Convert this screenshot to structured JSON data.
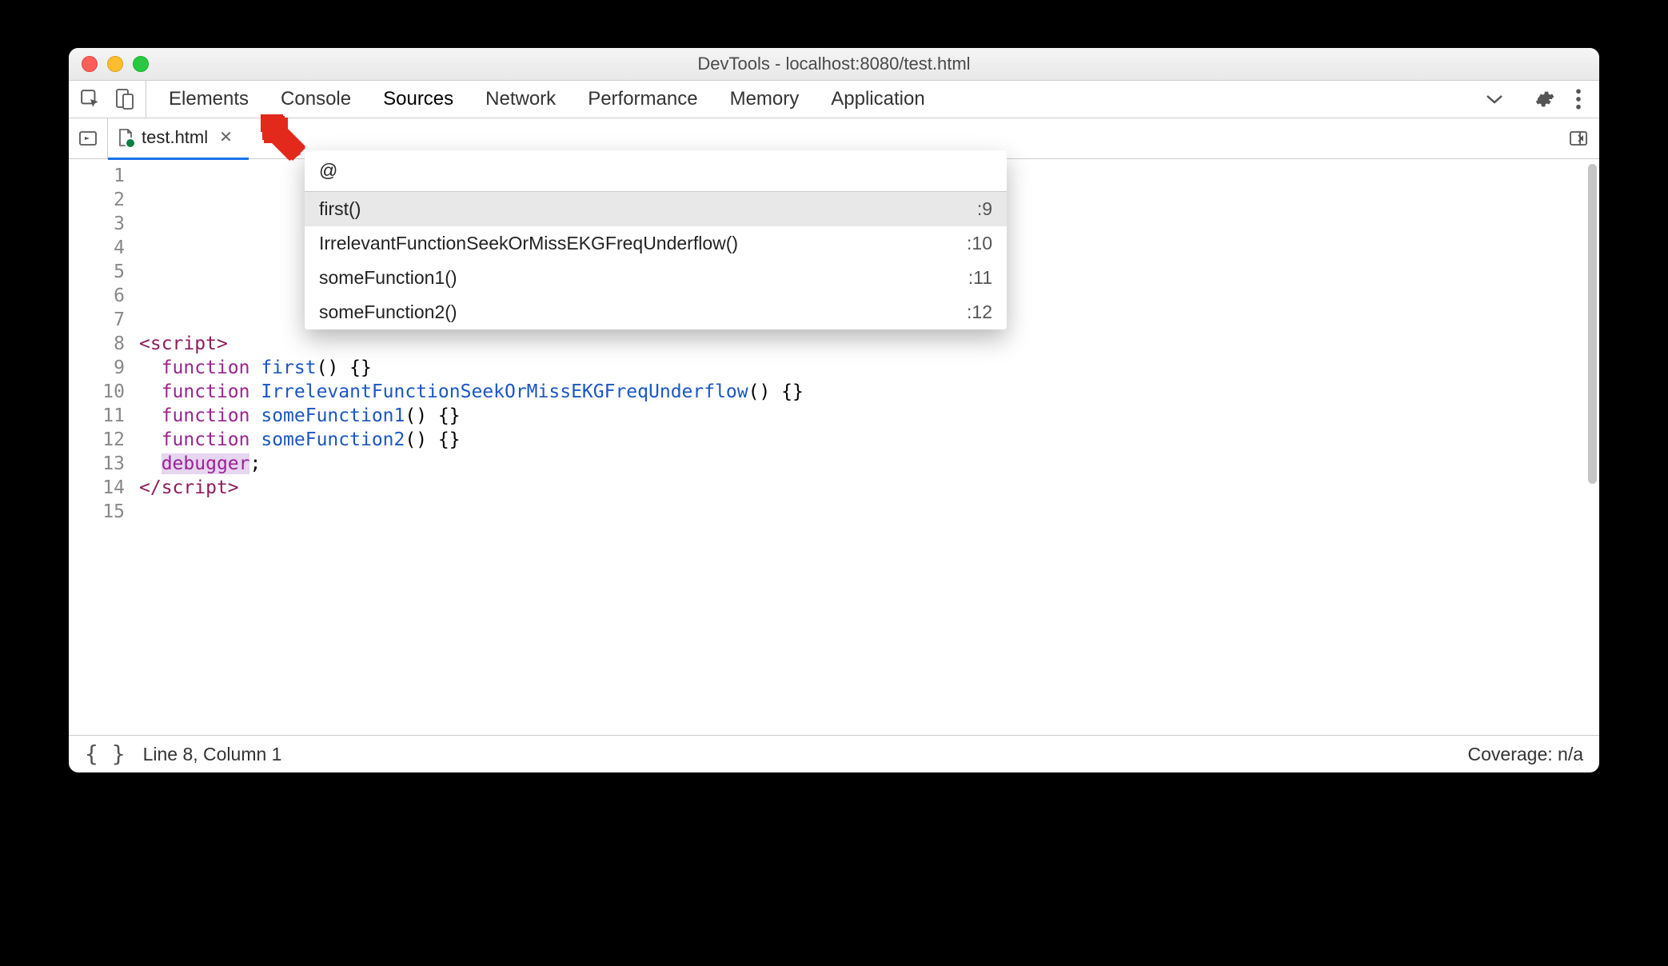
{
  "window": {
    "title": "DevTools - localhost:8080/test.html"
  },
  "toolbar": {
    "tabs": [
      "Elements",
      "Console",
      "Sources",
      "Network",
      "Performance",
      "Memory",
      "Application"
    ],
    "active_tab": "Sources"
  },
  "file": {
    "name": "test.html"
  },
  "command_menu": {
    "query": "@",
    "items": [
      {
        "label": "first()",
        "line": ":9"
      },
      {
        "label": "IrrelevantFunctionSeekOrMissEKGFreqUnderflow()",
        "line": ":10"
      },
      {
        "label": "someFunction1()",
        "line": ":11"
      },
      {
        "label": "someFunction2()",
        "line": ":12"
      }
    ],
    "selected_index": 0
  },
  "editor": {
    "line_numbers": [
      "1",
      "2",
      "3",
      "4",
      "5",
      "6",
      "7",
      "8",
      "9",
      "10",
      "11",
      "12",
      "13",
      "14",
      "15"
    ],
    "lines": [
      {
        "tokens": []
      },
      {
        "tokens": []
      },
      {
        "tokens": []
      },
      {
        "tokens": []
      },
      {
        "tokens": []
      },
      {
        "tokens": []
      },
      {
        "tokens": []
      },
      {
        "tokens": [
          {
            "t": "<",
            "c": "tag"
          },
          {
            "t": "script",
            "c": "tag"
          },
          {
            "t": ">",
            "c": "tag"
          }
        ]
      },
      {
        "tokens": [
          {
            "t": "  "
          },
          {
            "t": "function",
            "c": "kw"
          },
          {
            "t": " "
          },
          {
            "t": "first",
            "c": "fn"
          },
          {
            "t": "() {}"
          }
        ]
      },
      {
        "tokens": [
          {
            "t": "  "
          },
          {
            "t": "function",
            "c": "kw"
          },
          {
            "t": " "
          },
          {
            "t": "IrrelevantFunctionSeekOrMissEKGFreqUnderflow",
            "c": "fn"
          },
          {
            "t": "() {}"
          }
        ]
      },
      {
        "tokens": [
          {
            "t": "  "
          },
          {
            "t": "function",
            "c": "kw"
          },
          {
            "t": " "
          },
          {
            "t": "someFunction1",
            "c": "fn"
          },
          {
            "t": "() {}"
          }
        ]
      },
      {
        "tokens": [
          {
            "t": "  "
          },
          {
            "t": "function",
            "c": "kw"
          },
          {
            "t": " "
          },
          {
            "t": "someFunction2",
            "c": "fn"
          },
          {
            "t": "() {}"
          }
        ]
      },
      {
        "tokens": [
          {
            "t": "  "
          },
          {
            "t": "debugger",
            "c": "kw dbg"
          },
          {
            "t": ";"
          }
        ]
      },
      {
        "tokens": [
          {
            "t": "</",
            "c": "tag"
          },
          {
            "t": "script",
            "c": "tag"
          },
          {
            "t": ">",
            "c": "tag"
          }
        ]
      },
      {
        "tokens": []
      }
    ]
  },
  "statusbar": {
    "position": "Line 8, Column 1",
    "coverage": "Coverage: n/a"
  }
}
